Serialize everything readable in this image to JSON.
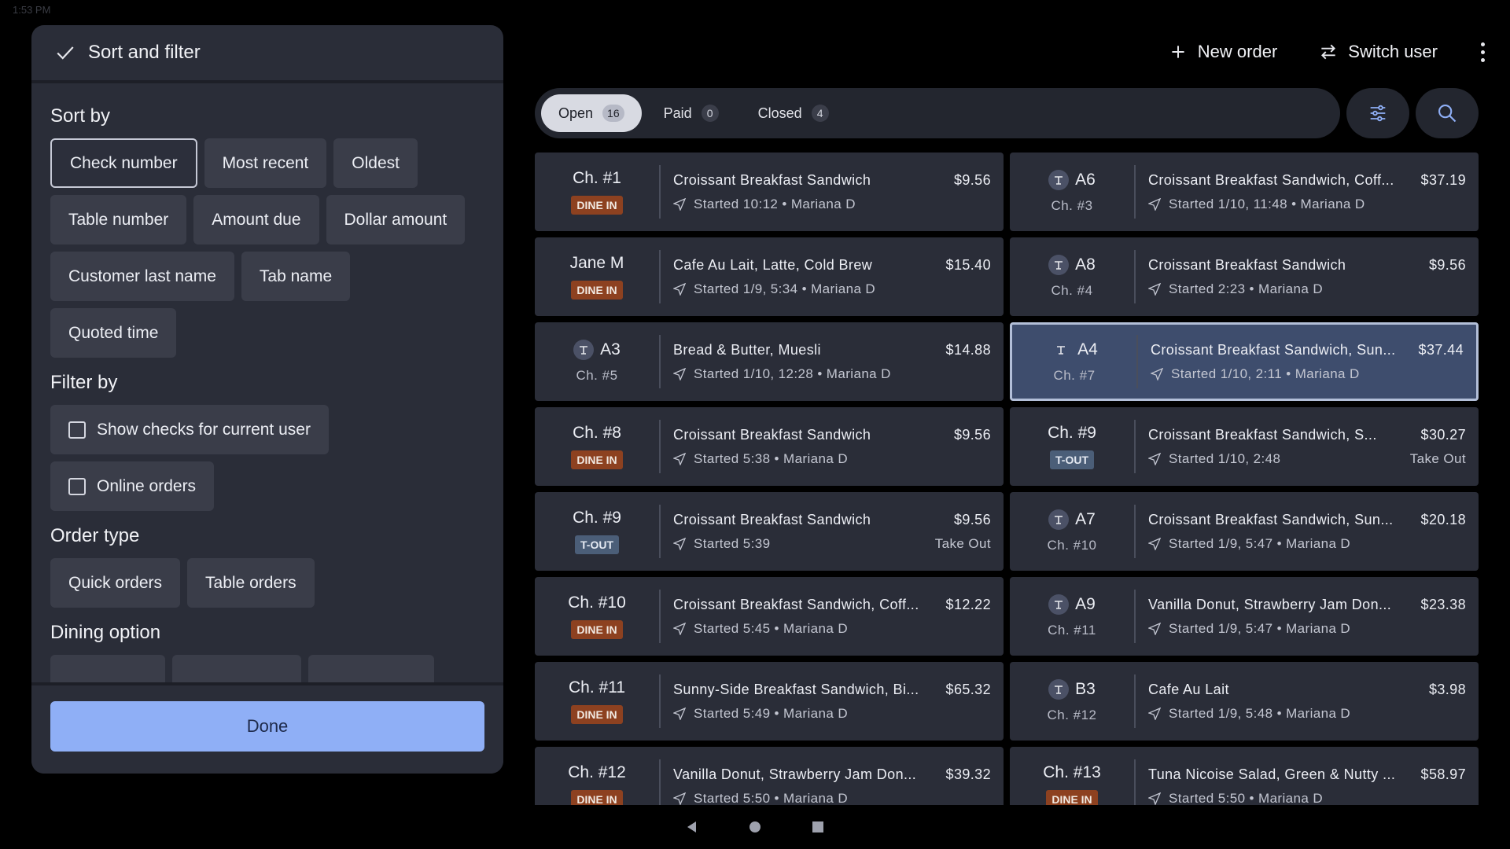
{
  "statusbar": {
    "time": "1:53 PM"
  },
  "panel": {
    "title": "Sort and filter",
    "sort_title": "Sort by",
    "sort_options": [
      "Check number",
      "Most recent",
      "Oldest",
      "Table number",
      "Amount due",
      "Dollar amount",
      "Customer last name",
      "Tab name",
      "Quoted time"
    ],
    "filter_title": "Filter by",
    "filter_options": [
      "Show checks for current user",
      "Online orders"
    ],
    "order_type_title": "Order type",
    "order_types": [
      "Quick orders",
      "Table orders"
    ],
    "dining_title": "Dining option",
    "done_label": "Done"
  },
  "header": {
    "new_order": "New order",
    "switch_user": "Switch user"
  },
  "tabs": [
    {
      "label": "Open",
      "count": "16"
    },
    {
      "label": "Paid",
      "count": "0"
    },
    {
      "label": "Closed",
      "count": "4"
    }
  ],
  "orders": [
    {
      "label": "Ch. #1",
      "badge": "DINE IN",
      "items": "Croissant Breakfast Sandwich",
      "price": "$9.56",
      "meta": "Started 10:12 • Mariana D",
      "extra": ""
    },
    {
      "label": "A6",
      "sub": "Ch. #3",
      "items": "Croissant Breakfast Sandwich, Coff...",
      "price": "$37.19",
      "meta": "Started 1/10, 11:48 • Mariana D",
      "extra": ""
    },
    {
      "label": "Jane M",
      "badge": "DINE IN",
      "items": "Cafe Au Lait, Latte, Cold Brew",
      "price": "$15.40",
      "meta": "Started 1/9, 5:34 • Mariana D",
      "extra": ""
    },
    {
      "label": "A8",
      "sub": "Ch. #4",
      "items": "Croissant Breakfast Sandwich",
      "price": "$9.56",
      "meta": "Started 2:23 • Mariana D",
      "extra": ""
    },
    {
      "label": "A3",
      "sub": "Ch. #5",
      "items": "Bread & Butter, Muesli",
      "price": "$14.88",
      "meta": "Started 1/10, 12:28 • Mariana D",
      "extra": ""
    },
    {
      "label": "A4",
      "sub": "Ch. #7",
      "items": "Croissant Breakfast Sandwich, Sun...",
      "price": "$37.44",
      "meta": "Started 1/10, 2:11 • Mariana D",
      "extra": ""
    },
    {
      "label": "Ch. #8",
      "badge": "DINE IN",
      "items": "Croissant Breakfast Sandwich",
      "price": "$9.56",
      "meta": "Started 5:38 • Mariana D",
      "extra": ""
    },
    {
      "label": "Ch. #9",
      "badge": "T-OUT",
      "items": "Croissant Breakfast Sandwich, S...",
      "price": "$30.27",
      "meta": "Started 1/10, 2:48",
      "extra": "Take Out"
    },
    {
      "label": "Ch. #9",
      "badge": "T-OUT",
      "items": "Croissant Breakfast Sandwich",
      "price": "$9.56",
      "meta": "Started 5:39",
      "extra": "Take Out"
    },
    {
      "label": "A7",
      "sub": "Ch. #10",
      "items": "Croissant Breakfast Sandwich, Sun...",
      "price": "$20.18",
      "meta": "Started 1/9, 5:47 • Mariana D",
      "extra": ""
    },
    {
      "label": "Ch. #10",
      "badge": "DINE IN",
      "items": "Croissant Breakfast Sandwich, Coff...",
      "price": "$12.22",
      "meta": "Started 5:45 • Mariana D",
      "extra": ""
    },
    {
      "label": "A9",
      "sub": "Ch. #11",
      "items": "Vanilla Donut, Strawberry Jam Don...",
      "price": "$23.38",
      "meta": "Started 1/9, 5:47 • Mariana D",
      "extra": ""
    },
    {
      "label": "Ch. #11",
      "badge": "DINE IN",
      "items": "Sunny-Side Breakfast Sandwich, Bi...",
      "price": "$65.32",
      "meta": "Started 5:49 • Mariana D",
      "extra": ""
    },
    {
      "label": "B3",
      "sub": "Ch. #12",
      "items": "Cafe Au Lait",
      "price": "$3.98",
      "meta": "Started 1/9, 5:48 • Mariana D",
      "extra": ""
    },
    {
      "label": "Ch. #12",
      "badge": "DINE IN",
      "items": "Vanilla Donut, Strawberry Jam Don...",
      "price": "$39.32",
      "meta": "Started 5:50 • Mariana D",
      "extra": ""
    },
    {
      "label": "Ch. #13",
      "badge": "DINE IN",
      "items": "Tuna Nicoise Salad, Green & Nutty ...",
      "price": "$58.97",
      "meta": "Started 5:50 • Mariana D",
      "extra": ""
    }
  ],
  "colors": {
    "accent": "#8faff6",
    "dine_in": "#8d4120",
    "take_out": "#4b5e78",
    "selected_card": "#3e4d6d"
  },
  "icons": {
    "table": "table-icon",
    "sent": "paper-plane-icon"
  }
}
